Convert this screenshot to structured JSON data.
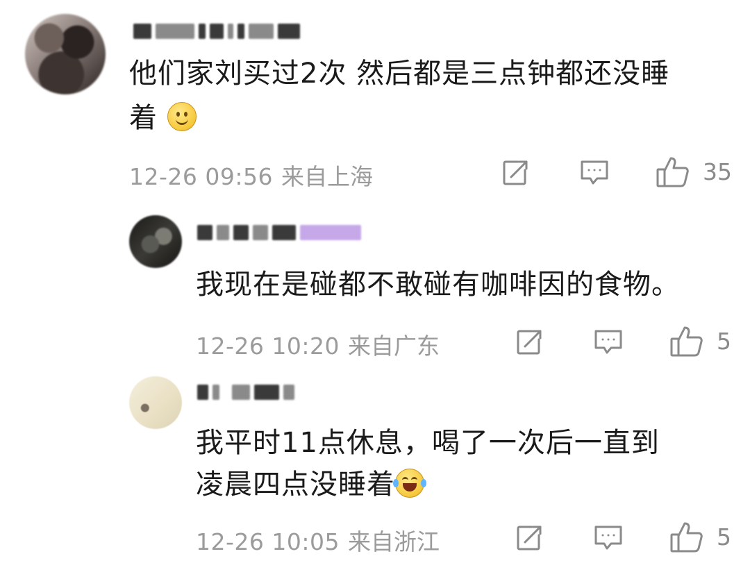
{
  "comments": [
    {
      "text_line1": "他们家刘买过2次 然后都是三点钟都还没睡",
      "text_line2": "着",
      "emoji": "smile-emoji",
      "time": "12-26 09:56",
      "location": "来自上海",
      "likes": "35"
    }
  ],
  "replies": [
    {
      "text_line1": "我现在是碰都不敢碰有咖啡因的食物。",
      "time": "12-26 10:20",
      "location": "来自广东",
      "likes": "5"
    },
    {
      "text_line1": "我平时11点休息，喝了一次后一直到",
      "text_line2": "凌晨四点没睡着",
      "emoji": "laugh-cry-emoji",
      "time": "12-26 10:05",
      "location": "来自浙江",
      "likes": "5"
    }
  ],
  "icons": {
    "share": "share-icon",
    "comment": "comment-icon",
    "like": "thumbs-up-icon"
  },
  "colors": {
    "text": "#1a1a1a",
    "meta": "#9b9b9b",
    "icon": "#8a8a8a",
    "vip_badge": "#c6a8e8"
  }
}
